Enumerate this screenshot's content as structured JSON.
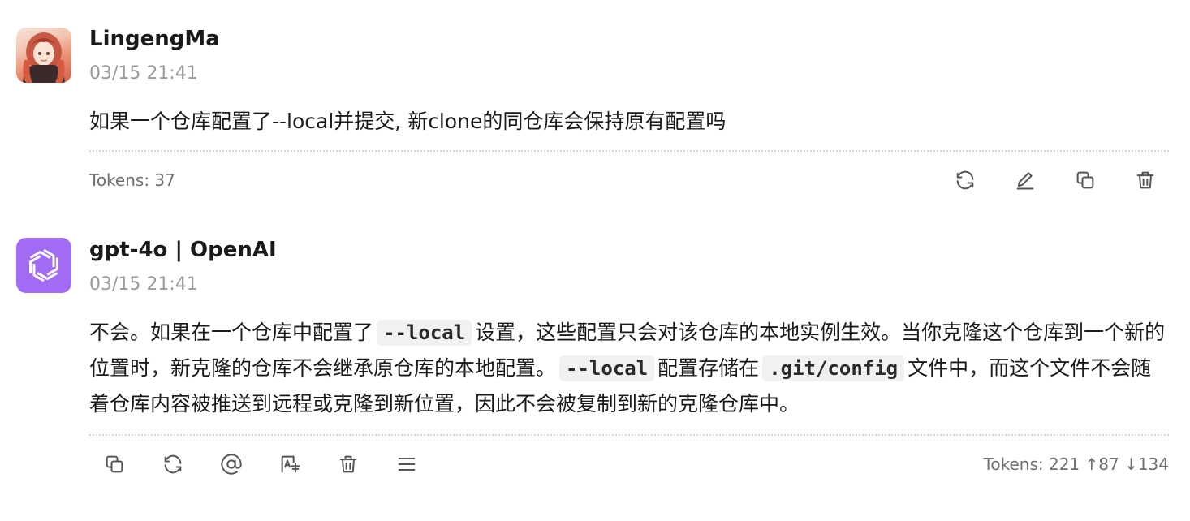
{
  "user_message": {
    "name": "LingengMa",
    "time": "03/15 21:41",
    "text": "如果一个仓库配置了--local并提交, 新clone的同仓库会保持原有配置吗",
    "tokens": "Tokens: 37",
    "actions": [
      "refresh-icon",
      "edit-icon",
      "copy-icon",
      "delete-icon"
    ]
  },
  "assistant_message": {
    "name": "gpt-4o | OpenAI",
    "time": "03/15 21:41",
    "text_segments": {
      "s1": "不会。如果在一个仓库中配置了",
      "code1": "--local",
      "s2": "设置，这些配置只会对该仓库的本地实例生效。当你克隆这个仓库到一个新的位置时，新克隆的仓库不会继承原仓库的本地配置。",
      "code2": "--local",
      "s3": "配置存储在",
      "code3": ".git/config",
      "s4": "文件中，而这个文件不会随着仓库内容被推送到远程或克隆到新位置，因此不会被复制到新的克隆仓库中。"
    },
    "tokens": "Tokens: 221 ↑87 ↓134",
    "actions": [
      "copy-icon",
      "regenerate-icon",
      "mention-icon",
      "translate-icon",
      "delete-icon",
      "menu-icon"
    ]
  },
  "colors": {
    "assistant_avatar": "#a16cf3",
    "meta_text": "#9a9a9a",
    "icon": "#555555"
  }
}
